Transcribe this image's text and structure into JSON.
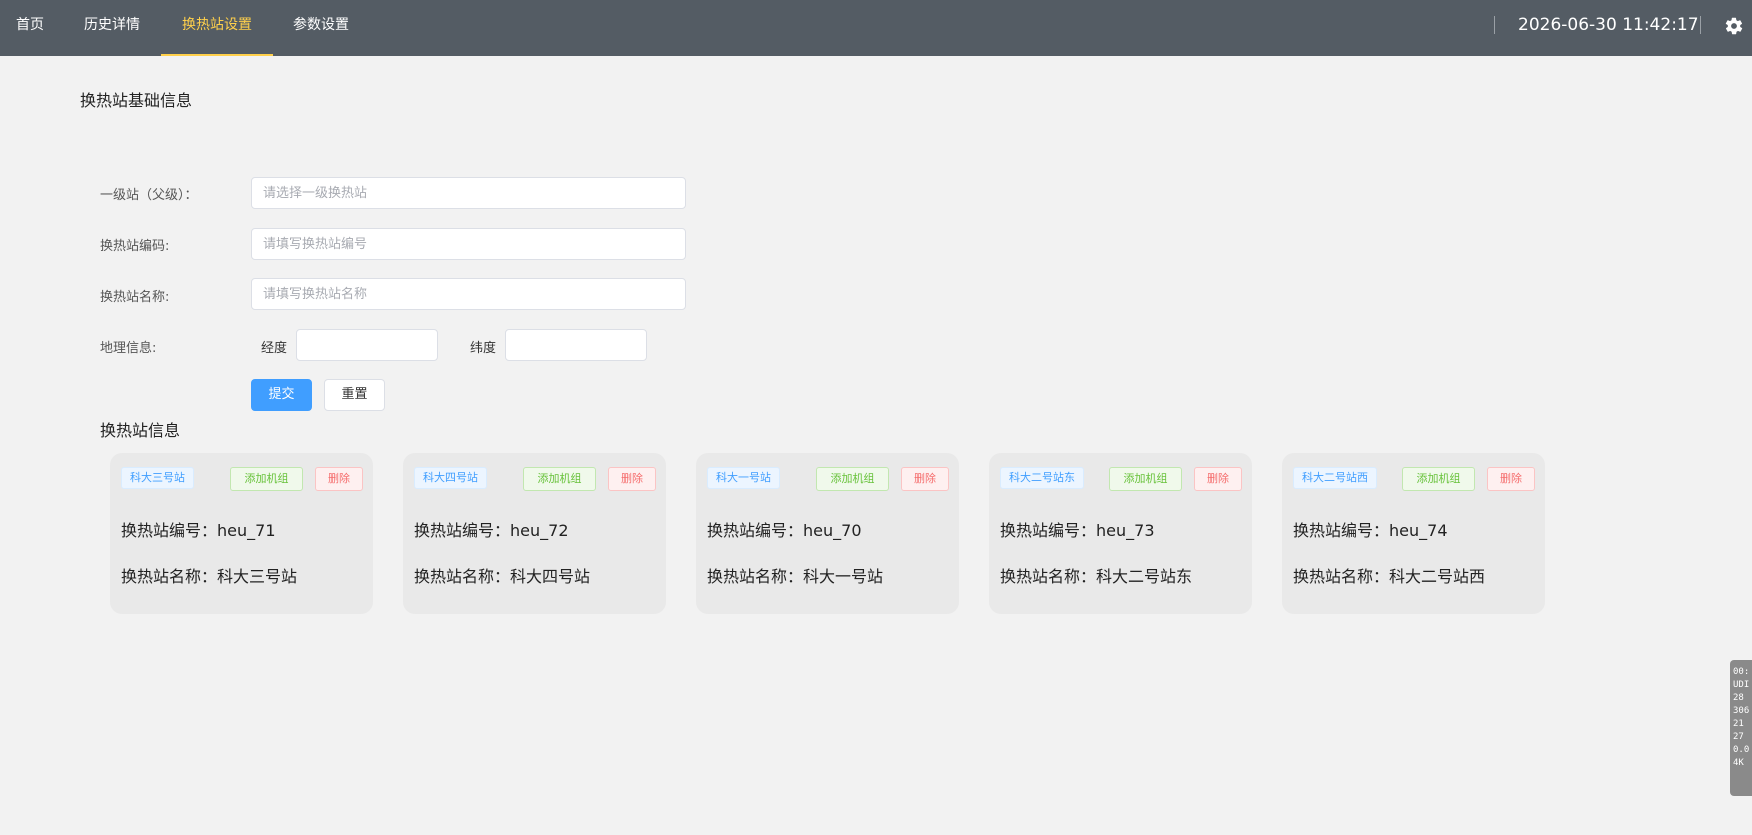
{
  "nav": {
    "items": [
      {
        "label": "首页",
        "active": false
      },
      {
        "label": "历史详情",
        "active": false
      },
      {
        "label": "换热站设置",
        "active": true
      },
      {
        "label": "参数设置",
        "active": false
      }
    ],
    "datetime": "2026-06-30 11:42:17",
    "settings_icon": "gear-icon"
  },
  "basic_info": {
    "title": "换热站基础信息",
    "parent_label": "一级站（父级）：",
    "parent_placeholder": "请选择一级换热站",
    "code_label": "换热站编码:",
    "code_placeholder": "请填写换热站编号",
    "name_label": "换热站名称:",
    "name_placeholder": "请填写换热站名称",
    "geo_label": "地理信息:",
    "longitude_label": "经度",
    "longitude_value": "",
    "latitude_label": "纬度",
    "latitude_value": "",
    "submit_label": "提交",
    "reset_label": "重置"
  },
  "stations": {
    "title": "换热站信息",
    "add_label": "添加机组",
    "delete_label": "删除",
    "code_prefix": "换热站编号：",
    "name_prefix": "换热站名称：",
    "items": [
      {
        "tag": "科大三号站",
        "code": "heu_71",
        "name": "科大三号站"
      },
      {
        "tag": "科大四号站",
        "code": "heu_72",
        "name": "科大四号站"
      },
      {
        "tag": "科大一号站",
        "code": "heu_70",
        "name": "科大一号站"
      },
      {
        "tag": "科大二号站东",
        "code": "heu_73",
        "name": "科大二号站东"
      },
      {
        "tag": "科大二号站西",
        "code": "heu_74",
        "name": "科大二号站西"
      }
    ]
  },
  "side_widget": {
    "lines": [
      "00:",
      "UDI",
      "28",
      "306",
      "21",
      "27",
      "0.0",
      "4K"
    ]
  },
  "colors": {
    "topbar": "#545c64",
    "active_nav": "#ffd04b",
    "primary": "#409eff",
    "success": "#67c23a",
    "danger": "#f56c6c"
  }
}
